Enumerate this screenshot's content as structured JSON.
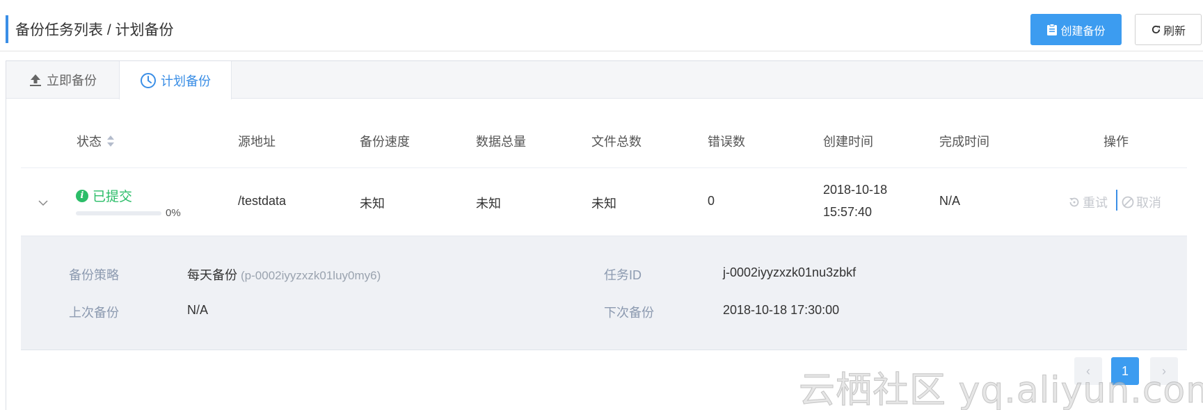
{
  "header": {
    "title": "备份任务列表 / 计划备份",
    "create_button": "创建备份",
    "refresh_button": "刷新"
  },
  "tabs": [
    {
      "label": "立即备份",
      "icon": "upload-icon",
      "active": false
    },
    {
      "label": "计划备份",
      "icon": "clock-icon",
      "active": true
    }
  ],
  "table": {
    "columns": [
      "状态",
      "源地址",
      "备份速度",
      "数据总量",
      "文件总数",
      "错误数",
      "创建时间",
      "完成时间",
      "操作"
    ],
    "rows": [
      {
        "status": "已提交",
        "progress_text": "0%",
        "progress": 0,
        "source": "/testdata",
        "speed": "未知",
        "total_data": "未知",
        "total_files": "未知",
        "errors": "0",
        "created_date": "2018-10-18",
        "created_time": "15:57:40",
        "finished": "N/A",
        "actions": [
          "重试",
          "取消"
        ]
      }
    ]
  },
  "detail": {
    "policy_label": "备份策略",
    "policy_value": "每天备份",
    "policy_id": "(p-0002iyyzxzk01luy0my6)",
    "task_id_label": "任务ID",
    "task_id_value": "j-0002iyyzxzk01nu3zbkf",
    "last_backup_label": "上次备份",
    "last_backup_value": "N/A",
    "next_backup_label": "下次备份",
    "next_backup_value": "2018-10-18 17:30:00"
  },
  "pagination": {
    "prev": "‹",
    "current": "1",
    "next": "›"
  },
  "watermark": "云栖社区 yq.aliyun.com",
  "colors": {
    "primary": "#3c9cf0",
    "success": "#2bbd68",
    "label": "#8c9ab0",
    "disabled": "#c5c8ce"
  }
}
